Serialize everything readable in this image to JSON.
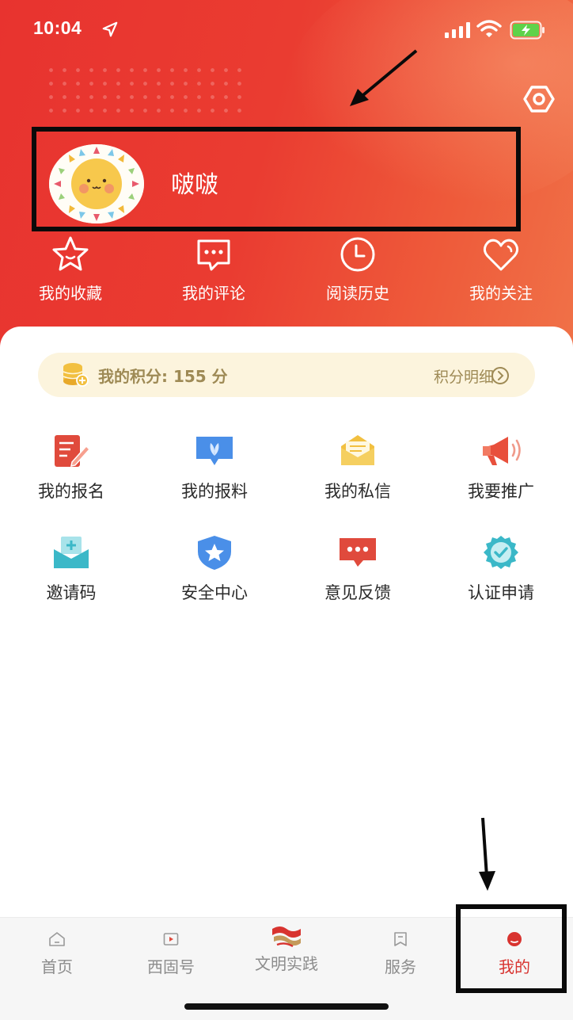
{
  "status_bar": {
    "time": "10:04"
  },
  "profile": {
    "user_name": "啵啵"
  },
  "quick_actions": [
    {
      "label": "我的收藏",
      "icon": "star-icon"
    },
    {
      "label": "我的评论",
      "icon": "comment-icon"
    },
    {
      "label": "阅读历史",
      "icon": "clock-icon"
    },
    {
      "label": "我的关注",
      "icon": "heart-icon"
    }
  ],
  "points": {
    "label": "我的积分: 155 分",
    "value": 155,
    "detail_label": "积分明细"
  },
  "services": [
    {
      "label": "我的报名",
      "icon": "signup-icon",
      "color": "#e04a3c"
    },
    {
      "label": "我的报料",
      "icon": "report-icon",
      "color": "#4a8fe8"
    },
    {
      "label": "我的私信",
      "icon": "mail-icon",
      "color": "#f2c040"
    },
    {
      "label": "我要推广",
      "icon": "megaphone-icon",
      "color": "#e8503c"
    },
    {
      "label": "邀请码",
      "icon": "invite-code-icon",
      "color": "#3bb8c8"
    },
    {
      "label": "安全中心",
      "icon": "shield-icon",
      "color": "#4a8fe8"
    },
    {
      "label": "意见反馈",
      "icon": "feedback-icon",
      "color": "#e04a3c"
    },
    {
      "label": "认证申请",
      "icon": "verify-badge-icon",
      "color": "#3bb8c8"
    }
  ],
  "bottom_nav": [
    {
      "label": "首页",
      "icon": "home-icon"
    },
    {
      "label": "西固号",
      "icon": "video-icon"
    },
    {
      "label": "文明实践",
      "icon": "logo-icon"
    },
    {
      "label": "服务",
      "icon": "service-icon"
    },
    {
      "label": "我的",
      "icon": "profile-icon",
      "active": true
    }
  ],
  "colors": {
    "accent": "#e8332f",
    "nav_active": "#d8332f",
    "points_bg": "#fcf4dd"
  }
}
